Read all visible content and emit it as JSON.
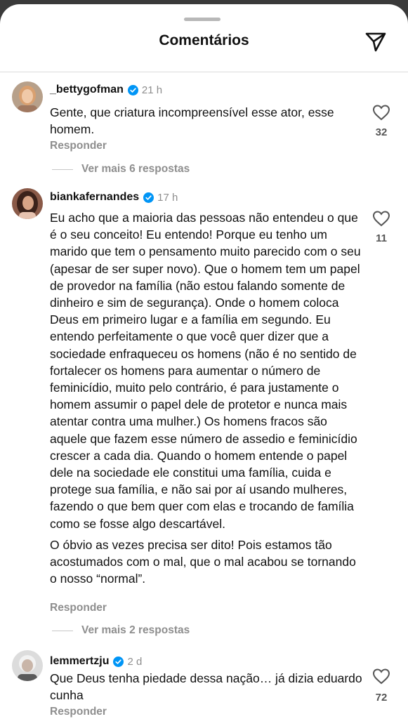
{
  "header": {
    "title": "Comentários",
    "send_icon": "send-icon"
  },
  "comments": [
    {
      "username": "_bettygofman",
      "verified": true,
      "time": "21 h",
      "paragraphs": [
        "Gente, que criatura incompreensível esse ator, esse homem."
      ],
      "reply_label": "Responder",
      "more_replies": "Ver mais 6 respostas",
      "likes": "32"
    },
    {
      "username": "biankafernandes",
      "verified": true,
      "time": "17 h",
      "paragraphs": [
        "Eu acho que a maioria das pessoas não entendeu o que é o seu conceito! Eu entendo! Porque eu tenho um marido que tem o pensamento muito parecido com o seu (apesar de ser super novo). Que o homem tem um papel de provedor na família (não estou falando somente de dinheiro e sim de segurança). Onde o homem coloca Deus em primeiro lugar e a família em segundo. Eu entendo perfeitamente o que você quer dizer que a sociedade enfraqueceu os homens (não é no sentido de fortalecer os homens para aumentar o número de feminicídio, muito pelo contrário, é para justamente o homem assumir o papel dele de protetor e nunca mais atentar contra uma mulher.) Os homens fracos são aquele que fazem esse número de assedio e feminicídio crescer a cada dia. Quando o homem entende o papel dele na sociedade ele constitui uma família, cuida e protege sua família, e não sai por aí usando mulheres, fazendo o que bem quer com elas e trocando de família como se fosse algo descartável.",
        "O óbvio as vezes precisa ser dito! Pois estamos tão acostumados com o mal, que o mal acabou se tornando o nosso “normal”."
      ],
      "reply_label": "Responder",
      "more_replies": "Ver mais 2 respostas",
      "likes": "11"
    },
    {
      "username": "lemmertzju",
      "verified": true,
      "time": "2 d",
      "paragraphs": [
        "Que Deus tenha piedade dessa nação… já dizia eduardo cunha"
      ],
      "reply_label": "Responder",
      "likes": "72"
    }
  ]
}
